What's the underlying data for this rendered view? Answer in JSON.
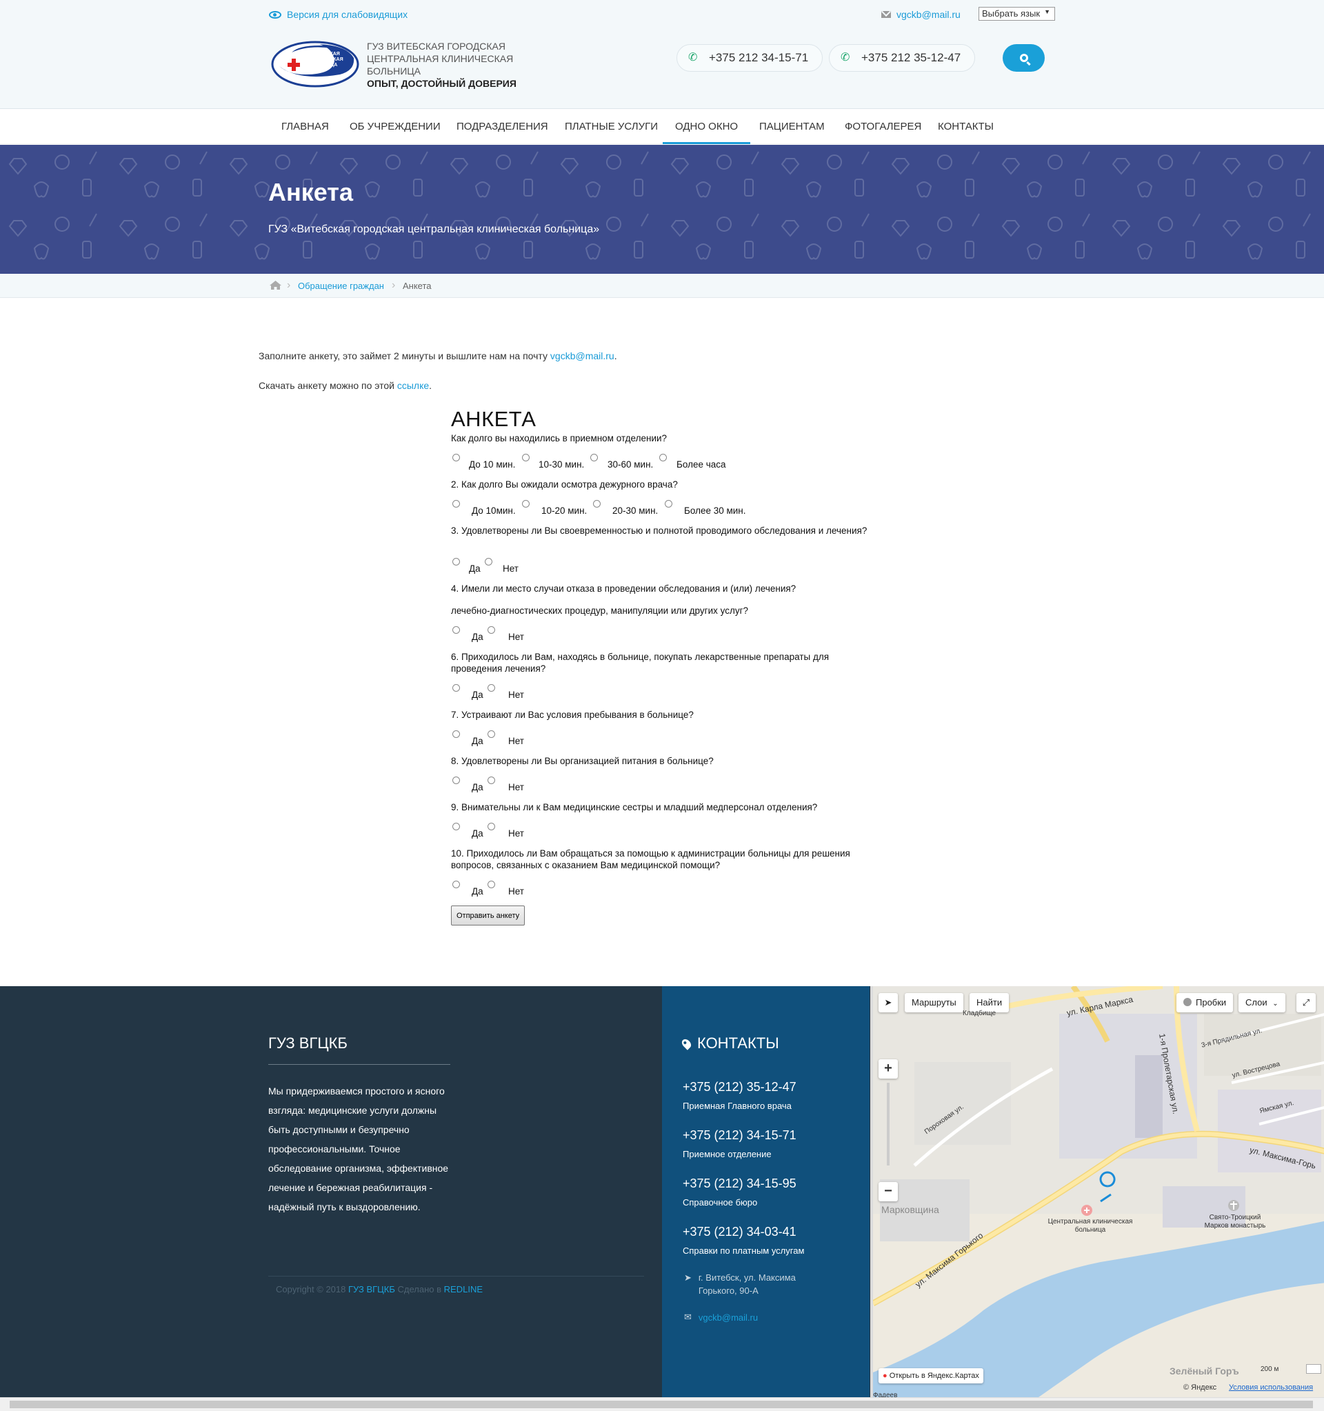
{
  "header": {
    "vision_link": "Версия для слабовидящих",
    "email": "vgckb@mail.ru",
    "language_select": "Выбрать язык",
    "org_name_line1": "ГУЗ ВИТЕБСКАЯ ГОРОДСКАЯ",
    "org_name_line2": "ЦЕНТРАЛЬНАЯ КЛИНИЧЕСКАЯ",
    "org_name_line3": "БОЛЬНИЦА",
    "slogan": "ОПЫТ, ДОСТОЙНЫЙ ДОВЕРИЯ",
    "logo_text": "ГОРОДСКАЯ КЛИНИЧЕСКАЯ БОЛЬНИЦА",
    "phone1": "+375 212 34-15-71",
    "phone2": "+375 212 35-12-47",
    "search_icon": "search-icon"
  },
  "nav": {
    "items": [
      {
        "label": "ГЛАВНАЯ"
      },
      {
        "label": "ОБ УЧРЕЖДЕНИИ"
      },
      {
        "label": "ПОДРАЗДЕЛЕНИЯ"
      },
      {
        "label": "ПЛАТНЫЕ УСЛУГИ"
      },
      {
        "label": "ОДНО ОКНО"
      },
      {
        "label": "ПАЦИЕНТАМ"
      },
      {
        "label": "ФОТОГАЛЕРЕЯ"
      },
      {
        "label": "КОНТАКТЫ"
      }
    ],
    "active": "ОДНО ОКНО"
  },
  "banner": {
    "title": "Анкета",
    "subtitle": "ГУЗ «Витебская городская центральная клиническая больница»"
  },
  "breadcrumb": {
    "home_icon": "home-icon",
    "item1": "Обращение граждан",
    "item2": "Анкета"
  },
  "intro": {
    "line1_text": "Заполните анкету, это займет 2 минуты и вышлите нам на почту ",
    "line1_link": "vgckb@mail.ru",
    "line1_end": ".",
    "line2_text": "Скачать анкету можно по этой ",
    "line2_link": "ссылке",
    "line2_end": "."
  },
  "form": {
    "title": "АНКЕТА",
    "questions": [
      {
        "text": "Как долго вы находились в приемном отделении?",
        "options": [
          "До 10 мин.",
          "10-30 мин.",
          "30-60 мин.",
          "Более часа"
        ]
      },
      {
        "text": "2. Как долго Вы ожидали осмотра дежурного врача?",
        "options": [
          "До 10мин.",
          "10-20 мин.",
          "20-30 мин.",
          "Более 30 мин."
        ]
      },
      {
        "text": "3. Удовлетворены ли Вы своевременностью и полнотой проводимого обследования и лечения?",
        "options": [
          "Да",
          "Нет"
        ]
      },
      {
        "text": "4. Имели ли место случаи отказа в проведении обследования и (или) лечения?",
        "options": []
      },
      {
        "text": "лечебно-диагностических процедур, манипуляции или других услуг?",
        "options": [
          "Да",
          "Нет"
        ]
      },
      {
        "text": "6. Приходилось ли Вам, находясь в больнице, покупать лекарственные препараты для проведения лечения?",
        "options": [
          "Да",
          "Нет"
        ]
      },
      {
        "text": "7. Устраивают ли Вас условия пребывания в больнице?",
        "options": [
          "Да",
          "Нет"
        ]
      },
      {
        "text": "8. Удовлетворены ли Вы организацией питания в больнице?",
        "options": [
          "Да",
          "Нет"
        ]
      },
      {
        "text": "9. Внимательны ли к Вам медицинские сестры и младший медперсонал отделения?",
        "options": [
          "Да",
          "Нет"
        ]
      },
      {
        "text": "10. Приходилось ли Вам обращаться за помощью к администрации больницы для решения вопросов, связанных с оказанием Вам медицинской помощи?",
        "options": [
          "Да",
          "Нет"
        ]
      }
    ],
    "submit_label": "Отправить анкету"
  },
  "footer": {
    "title": "ГУЗ ВГЦКБ",
    "text": "Мы придерживаемся простого и ясного взгляда: медицинские услуги должны быть доступными и безупречно профессиональными. Точное обследование организма, эффективное лечение и бережная реабилитация - надёжный путь к выздоровлению.",
    "copyright_prefix": "Copyright © 2018 ",
    "copyright_org": "ГУЗ ВГЦКБ",
    "copyright_mid": " Сделано в ",
    "copyright_dev": "REDLINE",
    "contacts_title": "КОНТАКТЫ",
    "contacts": [
      {
        "phone": "+375 (212) 35-12-47",
        "label": "Приемная Главного врача"
      },
      {
        "phone": "+375 (212) 34-15-71",
        "label": "Приемное отделение"
      },
      {
        "phone": "+375 (212) 34-15-95",
        "label": "Справочное бюро"
      },
      {
        "phone": "+375 (212) 34-03-41",
        "label": "Справки по платным услугам"
      }
    ],
    "address": "г. Витебск, ул. Максима Горького, 90-А",
    "email": "vgckb@mail.ru"
  },
  "map": {
    "routes_button": "Маршруты",
    "find_button": "Найти",
    "traffic_button": "Пробки",
    "layers_button": "Слои",
    "zoom_in": "+",
    "zoom_out": "−",
    "open_link": "Открыть в Яндекс.Картах",
    "scale": "200 м",
    "copyright": "© Яндекс",
    "terms": "Условия использования",
    "labels": {
      "street_marx": "ул. Карла Маркса",
      "street_proletar": "1-я Пролетарская ул.",
      "street_gorky": "ул. Максима Горького",
      "street_gorky2": "ул. Максима-Горь",
      "street_pohorova": "Пороховая ул.",
      "street_pryad": "3-я Прядильная ул.",
      "street_vostrec": "ул. Вострецова",
      "street_yam": "Ямская ул.",
      "district": "Марковщина",
      "hospital": "Центральная клиническая больница",
      "monastery": "Свято-Троицкий Марков монастырь",
      "green": "Зелёный Горъ",
      "cemetery": "Кладбище",
      "fadeeva": "Фадеев"
    }
  }
}
